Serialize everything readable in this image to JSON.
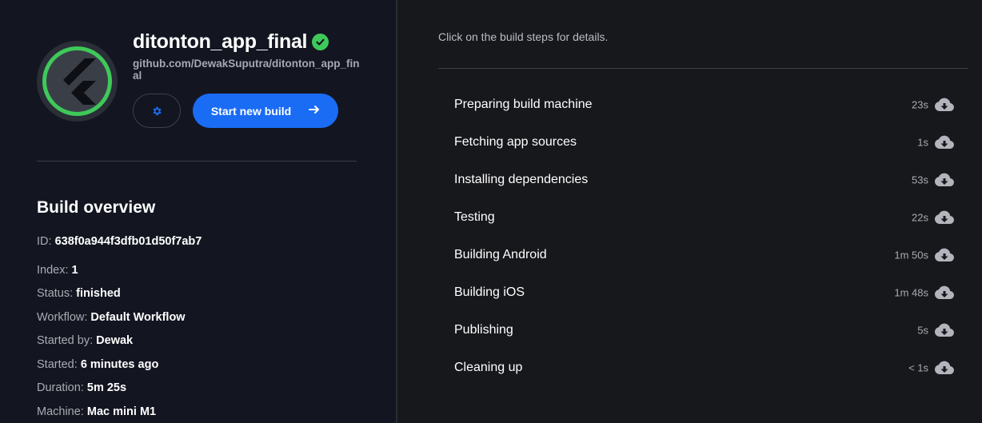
{
  "app": {
    "name": "ditonton_app_final",
    "repo": "github.com/DewakSuputra/ditonton_app_final",
    "status_icon": "check-circle-icon",
    "status_color": "#3ec95a",
    "settings_icon": "gear-icon",
    "start_build_label": "Start new build",
    "start_build_icon": "arrow-right-icon",
    "accent": "#1a6cf5"
  },
  "overview": {
    "title": "Build overview",
    "fields": [
      {
        "label": "ID:",
        "value": "638f0a944f3dfb01d50f7ab7"
      },
      {
        "label": "Index:",
        "value": "1"
      },
      {
        "label": "Status:",
        "value": "finished"
      },
      {
        "label": "Workflow:",
        "value": "Default Workflow"
      },
      {
        "label": "Started by:",
        "value": "Dewak"
      },
      {
        "label": "Started:",
        "value": "6 minutes ago"
      },
      {
        "label": "Duration:",
        "value": "5m 25s"
      },
      {
        "label": "Machine:",
        "value": "Mac mini M1"
      }
    ]
  },
  "steps_panel": {
    "hint": "Click on the build steps for details.",
    "steps": [
      {
        "name": "Preparing build machine",
        "duration": "23s"
      },
      {
        "name": "Fetching app sources",
        "duration": "1s"
      },
      {
        "name": "Installing dependencies",
        "duration": "53s"
      },
      {
        "name": "Testing",
        "duration": "22s"
      },
      {
        "name": "Building Android",
        "duration": "1m 50s"
      },
      {
        "name": "Building iOS",
        "duration": "1m 48s"
      },
      {
        "name": "Publishing",
        "duration": "5s"
      },
      {
        "name": "Cleaning up",
        "duration": "< 1s"
      }
    ],
    "download_icon": "cloud-download-icon"
  }
}
